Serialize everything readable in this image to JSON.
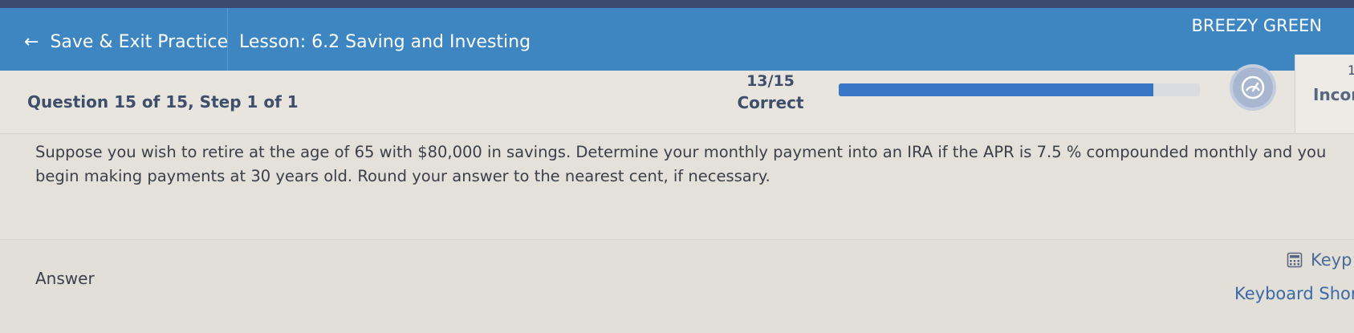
{
  "header": {
    "back_label": "Save & Exit Practice",
    "lesson_title": "Lesson: 6.2 Saving and Investing",
    "user_name": "BREEZY GREEN"
  },
  "progress": {
    "question_step": "Question 15 of 15, Step 1 of 1",
    "score_count": "13/15",
    "score_label": "Correct",
    "bar_fill_fraction": 0.87,
    "incorrect_count": "1",
    "incorrect_label": "Incor"
  },
  "question": {
    "text": "Suppose you wish to retire at the age of 65 with $80,000 in savings. Determine your monthly payment into an IRA if the APR is 7.5 %  compounded monthly and you\nbegin making payments at 30 years old. Round your answer to the nearest cent, if necessary."
  },
  "answer": {
    "label": "Answer",
    "keypad_label": "Keyp",
    "shortcuts_label": "Keyboard Shor"
  },
  "colors": {
    "header_bg": "#3e86c2",
    "accent": "#3676c4"
  },
  "icons": {
    "back": "arrow-left-icon",
    "badge": "gauge-icon",
    "keypad": "calculator-icon"
  }
}
